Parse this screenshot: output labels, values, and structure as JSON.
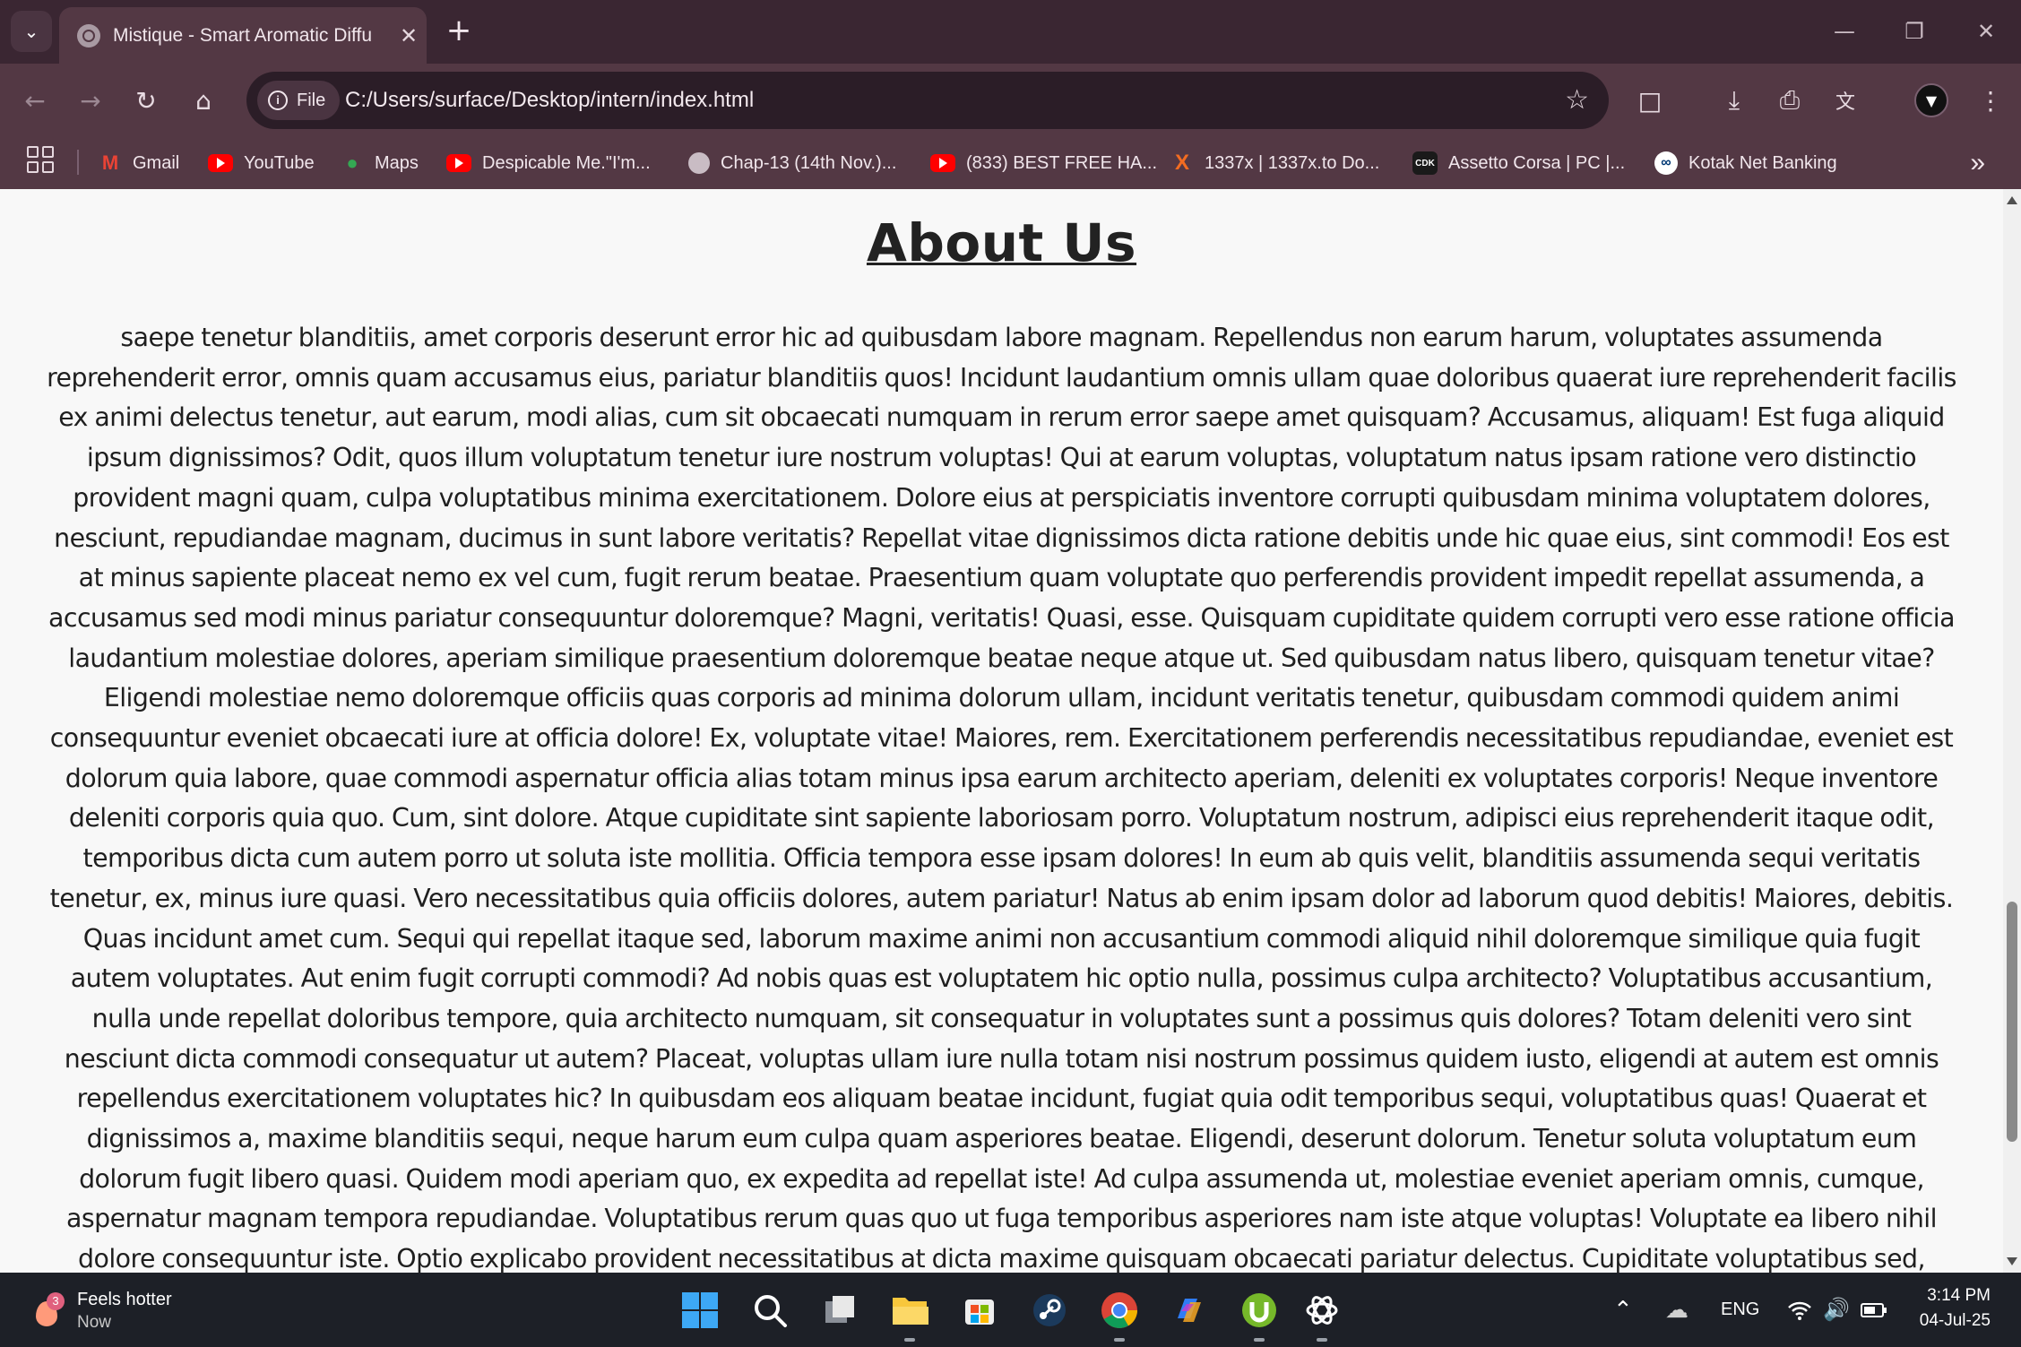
{
  "browser": {
    "tab_title": "Mistique - Smart Aromatic Diffu",
    "url_chip": "File",
    "url": "C:/Users/surface/Desktop/intern/index.html"
  },
  "bookmarks": [
    {
      "label": "Gmail",
      "icon": "gmail-icon"
    },
    {
      "label": "YouTube",
      "icon": "youtube-icon"
    },
    {
      "label": "Maps",
      "icon": "maps-icon"
    },
    {
      "label": "Despicable Me.\"I'm...",
      "icon": "youtube-icon"
    },
    {
      "label": "Chap-13 (14th Nov.)...",
      "icon": "globe-icon"
    },
    {
      "label": "(833) BEST FREE HA...",
      "icon": "youtube-icon"
    },
    {
      "label": "1337x | 1337x.to Do...",
      "icon": "x-icon"
    },
    {
      "label": "Assetto Corsa | PC |...",
      "icon": "cdk-icon"
    },
    {
      "label": "Kotak Net Banking",
      "icon": "kotak-icon"
    }
  ],
  "page": {
    "heading": "About Us",
    "body": "saepe tenetur blanditiis, amet corporis deserunt error hic ad quibusdam labore magnam. Repellendus non earum harum, voluptates assumenda reprehenderit error, omnis quam accusamus eius, pariatur blanditiis quos! Incidunt laudantium omnis ullam quae doloribus quaerat iure reprehenderit facilis ex animi delectus tenetur, aut earum, modi alias, cum sit obcaecati numquam in rerum error saepe amet quisquam? Accusamus, aliquam! Est fuga aliquid ipsum dignissimos? Odit, quos illum voluptatum tenetur iure nostrum voluptas! Qui at earum voluptas, voluptatum natus ipsam ratione vero distinctio provident magni quam, culpa voluptatibus minima exercitationem. Dolore eius at perspiciatis inventore corrupti quibusdam minima voluptatem dolores, nesciunt, repudiandae magnam, ducimus in sunt labore veritatis? Repellat vitae dignissimos dicta ratione debitis unde hic quae eius, sint commodi! Eos est at minus sapiente placeat nemo ex vel cum, fugit rerum beatae. Praesentium quam voluptate quo perferendis provident impedit repellat assumenda, a accusamus sed modi minus pariatur consequuntur doloremque? Magni, veritatis! Quasi, esse. Quisquam cupiditate quidem corrupti vero esse ratione officia laudantium molestiae dolores, aperiam similique praesentium doloremque beatae neque atque ut. Sed quibusdam natus libero, quisquam tenetur vitae? Eligendi molestiae nemo doloremque officiis quas corporis ad minima dolorum ullam, incidunt veritatis tenetur, quibusdam commodi quidem animi consequuntur eveniet obcaecati iure at officia dolore! Ex, voluptate vitae! Maiores, rem. Exercitationem perferendis necessitatibus repudiandae, eveniet est dolorum quia labore, quae commodi aspernatur officia alias totam minus ipsa earum architecto aperiam, deleniti ex voluptates corporis! Neque inventore deleniti corporis quia quo. Cum, sint dolore. Atque cupiditate sint sapiente laboriosam porro. Voluptatum nostrum, adipisci eius reprehenderit itaque odit, temporibus dicta cum autem porro ut soluta iste mollitia. Officia tempora esse ipsam dolores! In eum ab quis velit, blanditiis assumenda sequi veritatis tenetur, ex, minus iure quasi. Vero necessitatibus quia officiis dolores, autem pariatur! Natus ab enim ipsam dolor ad laborum quod debitis! Maiores, debitis. Quas incidunt amet cum. Sequi qui repellat itaque sed, laborum maxime animi non accusantium commodi aliquid nihil doloremque similique quia fugit autem voluptates. Aut enim fugit corrupti commodi? Ad nobis quas est voluptatem hic optio nulla, possimus culpa architecto? Voluptatibus accusantium, nulla unde repellat doloribus tempore, quia architecto numquam, sit consequatur in voluptates sunt a possimus quis dolores? Totam deleniti vero sint nesciunt dicta commodi consequatur ut autem? Placeat, voluptas ullam iure nulla totam nisi nostrum possimus quidem iusto, eligendi at autem est omnis repellendus exercitationem voluptates hic? In quibusdam eos aliquam beatae incidunt, fugiat quia odit temporibus sequi, voluptatibus quas! Quaerat et dignissimos a, maxime blanditiis sequi, neque harum eum culpa quam asperiores beatae. Eligendi, deserunt dolorum. Tenetur soluta voluptatum eum dolorum fugit libero quasi. Quidem modi aperiam quo, ex expedita ad repellat iste! Ad culpa assumenda ut, molestiae eveniet aperiam omnis, cumque, aspernatur magnam tempora repudiandae. Voluptatibus rerum quas quo ut fuga temporibus asperiores nam iste atque voluptas! Voluptate ea libero nihil dolore consequuntur iste. Optio explicabo provident necessitatibus at dicta maxime quisquam obcaecati pariatur delectus. Cupiditate voluptatibus sed, consequuntur animi doloribus obcaecati, molestiae accusamus repudiandae sit, iusto commodi? Facere laborum debitis consequuntur ratione voluptas expedita obcaecati ipsa distinctio accusamus consectetur eum cumque repellat, cum aperiam."
  },
  "taskbar": {
    "weather_badge": "3",
    "weather_title": "Feels hotter",
    "weather_sub": "Now",
    "language": "ENG",
    "time": "3:14 PM",
    "date": "04-Jul-25"
  }
}
